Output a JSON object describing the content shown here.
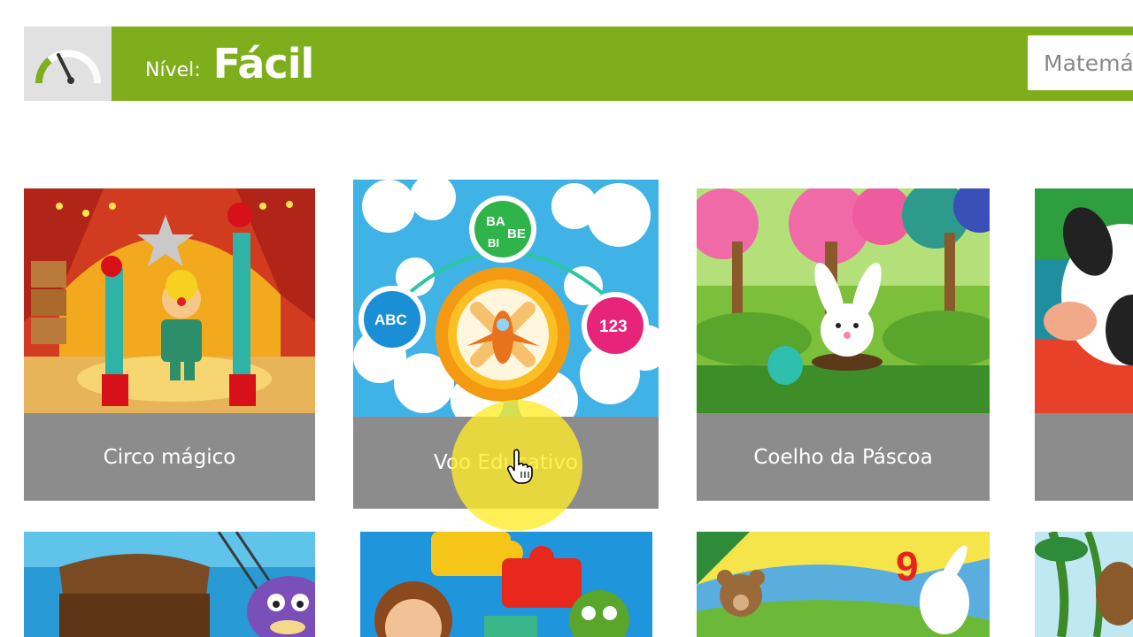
{
  "header": {
    "level_caption": "Nível:",
    "level_value": "Fácil",
    "subject_value": "Matemá"
  },
  "icons": {
    "gauge": "gauge-icon",
    "cursor": "hand-pointer-icon"
  },
  "colors": {
    "bar": "#7fae1d",
    "gauge_bg": "#e1e1e1",
    "card_label_bg": "#8c8c8c",
    "highlight": "#ffec28"
  },
  "games_row1": [
    {
      "title": "Circo mágico"
    },
    {
      "title": "Voo Educativo"
    },
    {
      "title": "Coelho da Páscoa"
    },
    {
      "title": ""
    }
  ],
  "badges": {
    "ba": "BA",
    "be": "BE",
    "bi": "BI",
    "abc": "ABC",
    "n123": "123",
    "nine": "9"
  }
}
